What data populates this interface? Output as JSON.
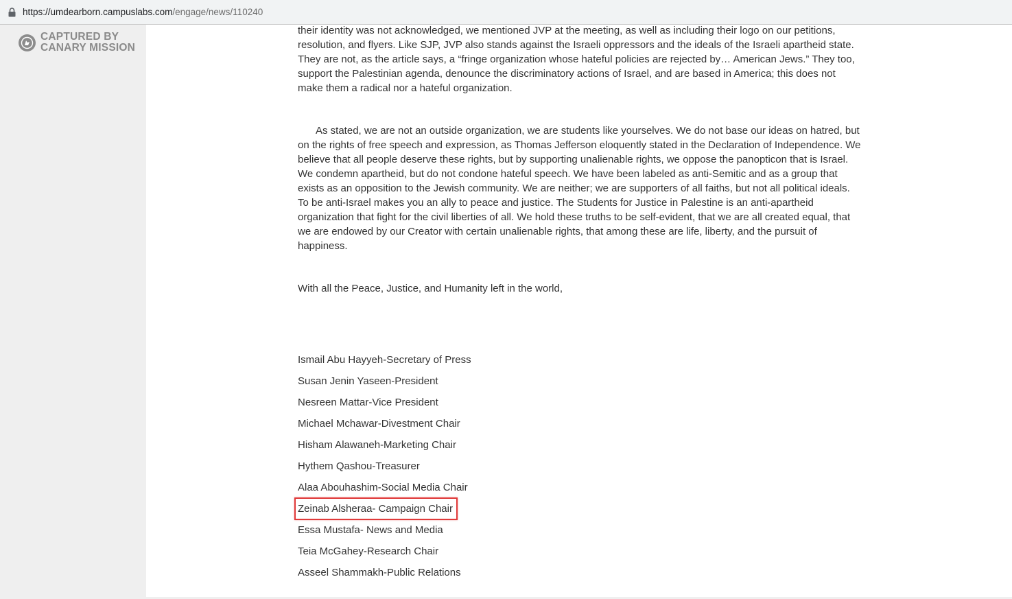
{
  "browser": {
    "url_host": "https://umdearborn.campuslabs.com",
    "url_path": "/engage/news/110240"
  },
  "watermark": {
    "line1": "CAPTURED BY",
    "line2": "CANARY MISSION"
  },
  "article": {
    "para1": "their identity was not acknowledged, we mentioned JVP at the meeting, as well as including their logo on our petitions, resolution, and flyers. Like SJP, JVP also stands against the Israeli oppressors and the ideals of the Israeli apartheid state. They are not, as the article says, a “fringe organization whose hateful policies are rejected by… American Jews.” They too, support the Palestinian agenda, denounce the discriminatory actions of Israel, and are based in America; this does not make them a radical nor a hateful organization.",
    "para2": "As stated, we are not an outside organization, we are students like yourselves. We do not base our ideas on hatred, but on the rights of free speech and expression, as Thomas Jefferson eloquently stated in the Declaration of Independence. We believe that all people deserve these rights, but by supporting unalienable rights, we oppose the panopticon that is Israel. We condemn apartheid, but do not condone hateful speech. We have been labeled as anti-Semitic and as a group that exists as an opposition to the Jewish community. We are neither; we are supporters of all faiths, but not all political ideals. To be anti-Israel makes you an ally to peace and justice. The Students for Justice in Palestine is an anti-apartheid organization that fight for the civil liberties of all. We hold these truths to be self-evident, that we are all created equal, that we are endowed by our Creator with certain unalienable rights, that among these are life, liberty, and the pursuit of happiness.",
    "closing": "With all the Peace, Justice, and Humanity left in the world,",
    "members": [
      "Ismail Abu Hayyeh-Secretary of Press",
      "Susan Jenin Yaseen-President",
      "Nesreen Mattar-Vice President",
      "Michael Mchawar-Divestment Chair",
      "Hisham Alawaneh-Marketing Chair",
      "Hythem Qashou-Treasurer",
      "Alaa Abouhashim-Social Media Chair",
      "Zeinab Alsheraa- Campaign Chair",
      "Essa Mustafa- News and Media",
      "Teia McGahey-Research Chair",
      "Asseel Shammakh-Public Relations"
    ]
  },
  "colors": {
    "highlight": "#e03a3a",
    "sidebar_bg": "#efefef",
    "text": "#333333"
  }
}
